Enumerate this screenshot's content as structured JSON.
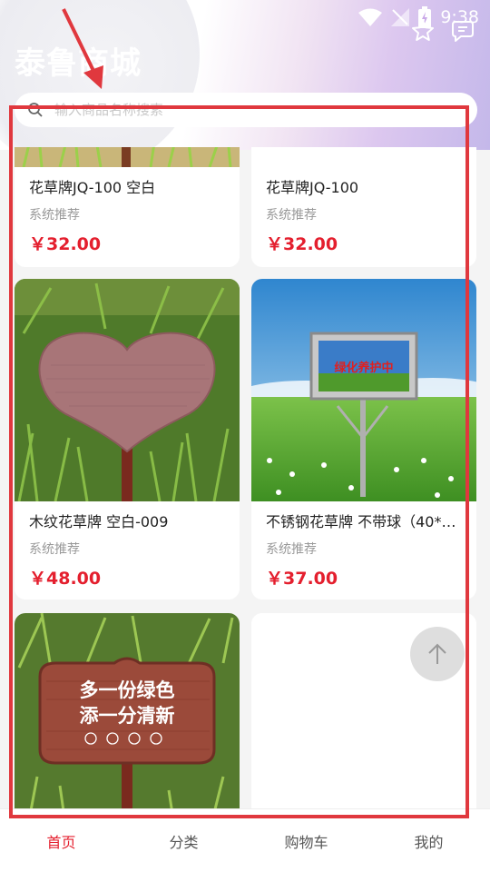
{
  "status": {
    "time": "9:38"
  },
  "header": {
    "title": "泰鲁商城"
  },
  "search": {
    "placeholder": "输入商品名称搜索"
  },
  "products": [
    {
      "name": "花草牌JQ-100 空白",
      "tag": "系统推荐",
      "price": "￥32.00"
    },
    {
      "name": "花草牌JQ-100",
      "tag": "系统推荐",
      "price": "￥32.00"
    },
    {
      "name": "木纹花草牌 空白-009",
      "tag": "系统推荐",
      "price": "￥48.00"
    },
    {
      "name": "不锈钢花草牌 不带球（40*…",
      "tag": "系统推荐",
      "price": "￥37.00"
    },
    {
      "sign_line1": "多一份绿色",
      "sign_line2": "添一分清新"
    }
  ],
  "sign_board_text": "绿化养护中",
  "bottom_nav": {
    "home": "首页",
    "category": "分类",
    "cart": "购物车",
    "mine": "我的"
  },
  "colors": {
    "accent": "#e41f2e",
    "annotation": "#e0383e"
  }
}
